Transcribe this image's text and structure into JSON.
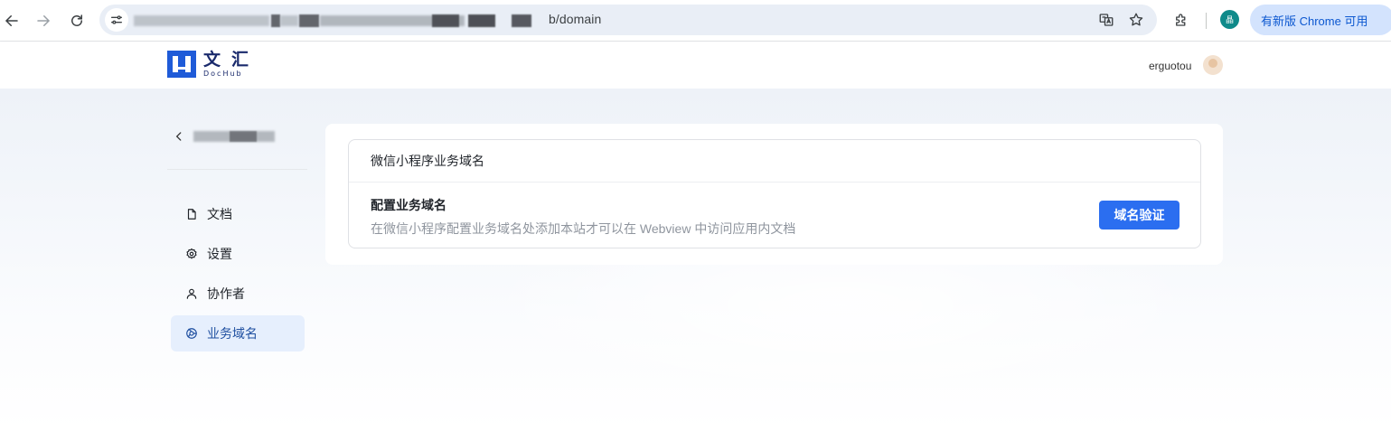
{
  "browser": {
    "url_visible": "b/domain",
    "update_label": "有新版 Chrome 可用",
    "profile_initial": "晶",
    "icons": [
      "back-arrow-icon",
      "forward-arrow-icon",
      "reload-icon",
      "site-info-icon",
      "translate-icon",
      "bookmark-star-icon",
      "extensions-icon"
    ]
  },
  "header": {
    "logo_cn": "文汇",
    "logo_en": "DocHub",
    "username": "erguotou"
  },
  "sidebar": {
    "back_icon": "chevron-left-icon",
    "library_title": "",
    "items": [
      {
        "label": "文档",
        "icon": "document-icon",
        "active": false
      },
      {
        "label": "设置",
        "icon": "gear-icon",
        "active": false
      },
      {
        "label": "协作者",
        "icon": "user-icon",
        "active": false
      },
      {
        "label": "业务域名",
        "icon": "globe-icon",
        "active": true
      }
    ]
  },
  "main": {
    "section_title": "微信小程序业务域名",
    "setting_title": "配置业务域名",
    "setting_desc": "在微信小程序配置业务域名处添加本站才可以在 Webview 中访问应用内文档",
    "verify_button": "域名验证"
  },
  "colors": {
    "accent": "#2b6ef0",
    "active_bg": "#e6effd",
    "brand": "#1a2a6c",
    "update_bg": "#d3e3fd"
  }
}
